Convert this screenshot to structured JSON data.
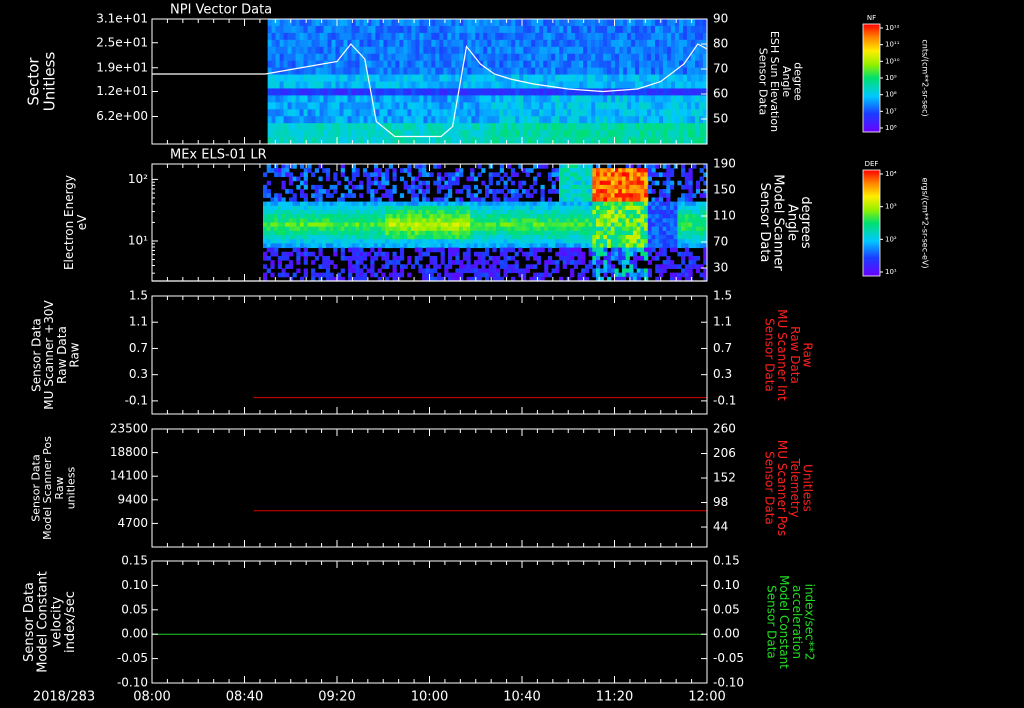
{
  "colors": {
    "background": "#000000",
    "axes": "#ffffff",
    "red_trace": "#dd0000",
    "green_trace": "#22cc22",
    "red_label": "#ff2020",
    "green_label": "#22dd22"
  },
  "x_axis": {
    "start_label": "2018/283",
    "ticks": [
      "08:00",
      "08:40",
      "09:20",
      "10:00",
      "10:40",
      "11:20",
      "12:00"
    ]
  },
  "chart_data": [
    {
      "type": "heatmap",
      "title": "NPI Vector Data",
      "ylabel": [
        "Sector",
        "Unitless"
      ],
      "y_tick_labels": [
        "3.1e+01",
        "2.5e+01",
        "1.9e+01",
        "1.2e+01",
        "6.2e+00"
      ],
      "right_ylabel": [
        "Sensor Data",
        "ESH Sun Elevation",
        "Angle",
        "degree"
      ],
      "right_ylim": [
        40,
        90
      ],
      "right_ticks": [
        90,
        80,
        70,
        60,
        50
      ],
      "colorbar": {
        "name": "NF",
        "unit": "cnts/(cm**2-sr-sec)",
        "scale": "log",
        "tick_labels": [
          "10¹²",
          "10¹¹",
          "10¹⁰",
          "10⁹",
          "10⁸",
          "10⁷",
          "10⁶"
        ]
      },
      "data_start_time": "08:50",
      "overlay_line": {
        "name": "ESH Sun Elevation Angle",
        "color": "#ffffff",
        "x": [
          "08:00",
          "08:49",
          "09:20",
          "09:26",
          "09:32",
          "09:37",
          "09:45",
          "09:55",
          "10:05",
          "10:10",
          "10:16",
          "10:22",
          "10:28",
          "10:35",
          "10:45",
          "11:00",
          "11:15",
          "11:30",
          "11:40",
          "11:50",
          "11:56",
          "12:00"
        ],
        "y": [
          68,
          68,
          73,
          80,
          74,
          49,
          43,
          43,
          43,
          47,
          79,
          72,
          68,
          66,
          64,
          62,
          61,
          62,
          65,
          72,
          80,
          78
        ]
      }
    },
    {
      "type": "heatmap",
      "title": "MEx ELS-01 LR",
      "ylabel": [
        "Electron Energy",
        "eV"
      ],
      "y_tick_labels": [
        "10²",
        "10¹"
      ],
      "y_scale": "log",
      "right_ylabel": [
        "Sensor Data",
        "Model Scanner",
        "Angle",
        "degrees"
      ],
      "right_ylim": [
        10,
        190
      ],
      "right_ticks": [
        190,
        150,
        110,
        70,
        30
      ],
      "colorbar": {
        "name": "DEF",
        "unit": "ergs/(cm**2-sr-sec-eV)",
        "scale": "log",
        "tick_labels": [
          "10⁴",
          "10³",
          "10²",
          "10¹"
        ]
      },
      "data_start_time": "08:48",
      "overlay_line": {
        "name": "Model Scanner Angle",
        "color": "#ffffff",
        "x": [
          "08:00",
          "12:00"
        ],
        "y": [
          10,
          10
        ]
      }
    },
    {
      "type": "line",
      "ylabel": [
        "Sensor Data",
        "MU Scanner +30V",
        "Raw Data",
        "Raw"
      ],
      "right_ylabel": [
        "Sensor Data",
        "MU Scanner Int",
        "Raw Data",
        "Raw"
      ],
      "ylim": [
        -0.3,
        1.5
      ],
      "y_ticks": [
        "1.5",
        "1.1",
        "0.7",
        "0.3",
        "-0.1"
      ],
      "right_ylim": [
        -0.3,
        1.5
      ],
      "right_ticks": [
        "1.5",
        "1.1",
        "0.7",
        "0.3",
        "-0.1"
      ],
      "series": [
        {
          "color": "#dd0000",
          "x": [
            "08:44",
            "12:00"
          ],
          "y": [
            -0.05,
            -0.05
          ]
        }
      ]
    },
    {
      "type": "line",
      "ylabel": [
        "Sensor Data",
        "Model Scanner Pos",
        "Raw",
        "unitless"
      ],
      "right_ylabel": [
        "Sensor Data",
        "MU Scanner Pos",
        "Telemetry",
        "Unitless"
      ],
      "ylim": [
        0,
        23500
      ],
      "y_ticks": [
        "23500",
        "18800",
        "14100",
        "9400",
        "4700"
      ],
      "right_ylim": [
        0,
        260
      ],
      "right_ticks": [
        "260",
        "206",
        "152",
        "98",
        "44"
      ],
      "series": [
        {
          "color": "#dd0000",
          "x": [
            "08:44",
            "12:00"
          ],
          "y": [
            7200,
            7200
          ]
        }
      ]
    },
    {
      "type": "line",
      "ylabel": [
        "Sensor Data",
        "Model Constant",
        "velocity",
        "index/sec"
      ],
      "right_ylabel": [
        "Sensor Data",
        "Model Constant",
        "acceleration",
        "index/sec**2"
      ],
      "ylim": [
        -0.1,
        0.15
      ],
      "y_ticks": [
        "0.15",
        "0.10",
        "0.05",
        "0.00",
        "-0.05",
        "-0.10"
      ],
      "right_ylim": [
        -0.1,
        0.15
      ],
      "right_ticks": [
        "0.15",
        "0.10",
        "0.05",
        "0.00",
        "-0.05",
        "-0.10"
      ],
      "series": [
        {
          "color": "#22cc22",
          "x": [
            "08:00",
            "12:00"
          ],
          "y": [
            0,
            0
          ]
        }
      ]
    }
  ]
}
